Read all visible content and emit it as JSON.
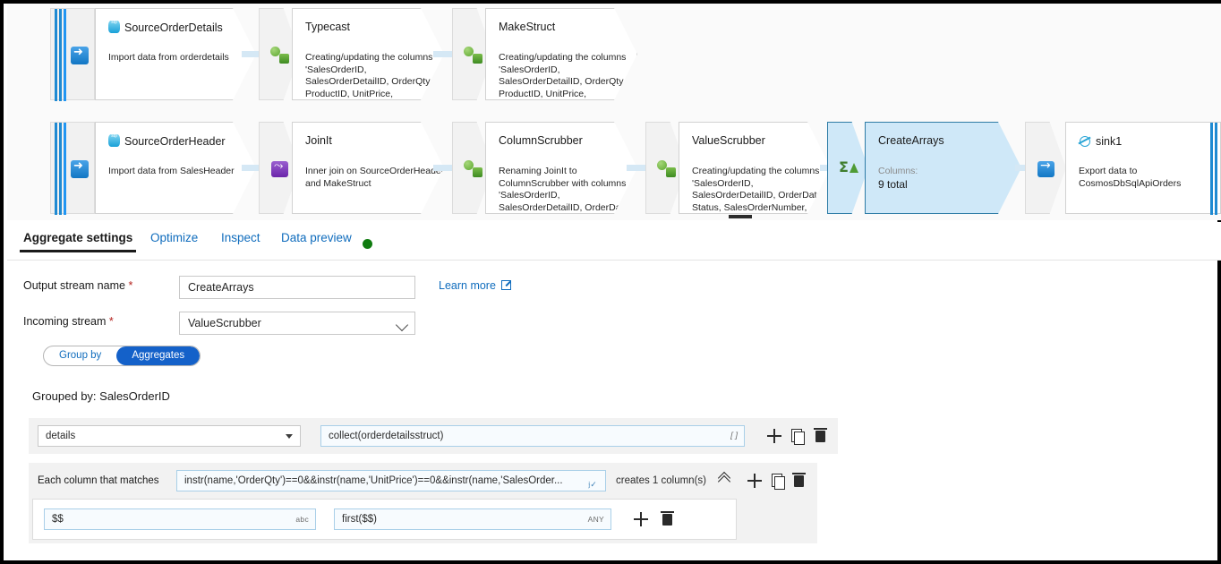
{
  "canvas": {
    "row1": [
      {
        "type": "source",
        "title": "SourceOrderDetails",
        "icon": "sql-database-icon",
        "desc": "Import data from orderdetails"
      },
      {
        "type": "derived",
        "title": "Typecast",
        "icon": "derived-column-icon",
        "desc": "Creating/updating the columns 'SalesOrderID, SalesOrderDetailID, OrderQty, ProductID, UnitPrice,"
      },
      {
        "type": "derived",
        "title": "MakeStruct",
        "icon": "derived-column-icon",
        "desc": "Creating/updating the columns 'SalesOrderID, SalesOrderDetailID, OrderQty, ProductID, UnitPrice,"
      }
    ],
    "row2": [
      {
        "type": "source",
        "title": "SourceOrderHeader",
        "icon": "sql-database-icon",
        "desc": "Import data from SalesHeader"
      },
      {
        "type": "join",
        "title": "JoinIt",
        "icon": "join-icon",
        "desc": "Inner join on SourceOrderHeader and MakeStruct"
      },
      {
        "type": "derived",
        "title": "ColumnScrubber",
        "icon": "derived-column-icon",
        "desc": "Renaming JoinIt to ColumnScrubber with columns 'SalesOrderID, SalesOrderDetailID, OrderDate,"
      },
      {
        "type": "derived",
        "title": "ValueScrubber",
        "icon": "derived-column-icon",
        "desc": "Creating/updating the columns 'SalesOrderID, SalesOrderDetailID, OrderDate, Status, SalesOrderNumber,"
      },
      {
        "type": "aggregate",
        "title": "CreateArrays",
        "icon": "aggregate-icon",
        "columns_label": "Columns:",
        "columns_value": "9 total",
        "selected": true
      },
      {
        "type": "sink",
        "title": "sink1",
        "icon": "cosmos-db-icon",
        "desc": "Export data to CosmosDbSqlApiOrders"
      }
    ],
    "plus_label": "+"
  },
  "tabs": [
    {
      "label": "Aggregate settings",
      "active": true
    },
    {
      "label": "Optimize",
      "active": false
    },
    {
      "label": "Inspect",
      "active": false
    },
    {
      "label": "Data preview",
      "active": false,
      "status_dot": "#107c10"
    }
  ],
  "form": {
    "output_stream_label": "Output stream name",
    "output_stream_value": "CreateArrays",
    "incoming_stream_label": "Incoming stream",
    "incoming_stream_value": "ValueScrubber",
    "required_marker": "*",
    "learn_more": "Learn more"
  },
  "toggle": {
    "group_by": "Group by",
    "aggregates": "Aggregates",
    "selected": "Aggregates"
  },
  "grouped_by_text": "Grouped by: SalesOrderID",
  "aggregate_rows": [
    {
      "column_name": "details",
      "expression": "collect(orderdetailsstruct)",
      "type_suffix": "[ ]"
    }
  ],
  "rule_row": {
    "label": "Each column that matches",
    "match_expression": "instr(name,'OrderQty')==0&&instr(name,'UnitPrice')==0&&instr(name,'SalesOrder...",
    "creates_text": "creates 1 column(s)",
    "name_expression": "$$",
    "name_type": "abc",
    "value_expression": "first($$)",
    "value_type": "ANY"
  },
  "colors": {
    "accent": "#0f6cbd",
    "selected_node_fill": "#cfe8f8",
    "selected_node_border": "#2e7ca6",
    "toggle_on": "#1461c9",
    "status_green": "#107c10"
  }
}
